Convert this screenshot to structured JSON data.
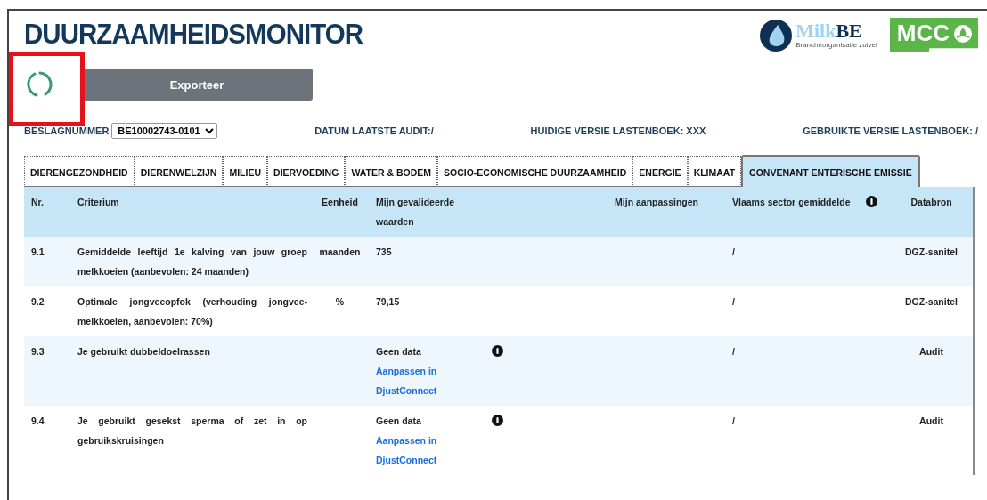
{
  "header": {
    "title": "DUURZAAMHEIDSMONITOR",
    "logos": [
      {
        "kind": "milkbe",
        "name_part": "Milk",
        "name_bold": "BE",
        "tagline": "Brancheorganisatie zuivel"
      },
      {
        "kind": "mcc",
        "name": "MCC"
      }
    ]
  },
  "loading": true,
  "export_button": "Exporteer",
  "farm": {
    "label": "BESLAGNUMMER",
    "value": "BE10002743-0101"
  },
  "meta": [
    "DATUM LAATSTE AUDIT:/",
    "HUIDIGE VERSIE LASTENBOEK: XXX",
    "GEBRUIKTE VERSIE LASTENBOEK: /"
  ],
  "tabs": [
    {
      "label": "DIERENGEZONDHEID",
      "selected": false
    },
    {
      "label": "DIERENWELZIJN",
      "selected": false
    },
    {
      "label": "MILIEU",
      "selected": false
    },
    {
      "label": "DIERVOEDING",
      "selected": false
    },
    {
      "label": "WATER & BODEM",
      "selected": false
    },
    {
      "label": "SOCIO-ECONOMISCHE DUURZAAMHEID",
      "selected": false
    },
    {
      "label": "ENERGIE",
      "selected": false
    },
    {
      "label": "KLIMAAT",
      "selected": false
    },
    {
      "label": "CONVENANT ENTERISCHE EMISSIE",
      "selected": true
    }
  ],
  "table": {
    "columns": [
      {
        "kind": "text",
        "label": "Nr."
      },
      {
        "kind": "text",
        "label": "Criterium"
      },
      {
        "kind": "text",
        "label": "Eenheid"
      },
      {
        "kind": "text",
        "label": "Mijn gevalideerde waarden"
      },
      {
        "kind": "text",
        "label": "Mijn aanpassingen"
      },
      {
        "kind": "text",
        "label": "Vlaams sector gemiddelde"
      },
      {
        "kind": "info"
      },
      {
        "kind": "text",
        "label": "Databron"
      }
    ],
    "rows": [
      {
        "nr": "9.1",
        "criterium": "Gemiddelde leeftijd 1e kalving van jouw groep melkkoeien (aanbevolen: 24 maanden)",
        "eenheid": "maanden",
        "value": "735",
        "info": false,
        "sector": "/",
        "databron": "DGZ-sanitel"
      },
      {
        "nr": "9.2",
        "criterium": "Optimale jongveeopfok (verhouding jongvee-melkkoeien, aanbevolen: 70%)",
        "eenheid": "%",
        "value": "79,15",
        "info": false,
        "sector": "/",
        "databron": "DGZ-sanitel"
      },
      {
        "nr": "9.3",
        "criterium": "Je gebruikt dubbeldoelrassen",
        "value": "Geen data",
        "link": "Aanpassen in DjustConnect",
        "info": true,
        "sector": "/",
        "databron": "Audit"
      },
      {
        "nr": "9.4",
        "criterium": "Je gebruikt gesekst sperma of zet in op gebruikskruisingen",
        "value": "Geen data",
        "link": "Aanpassen in DjustConnect",
        "info": true,
        "sector": "/",
        "databron": "Audit"
      }
    ]
  }
}
